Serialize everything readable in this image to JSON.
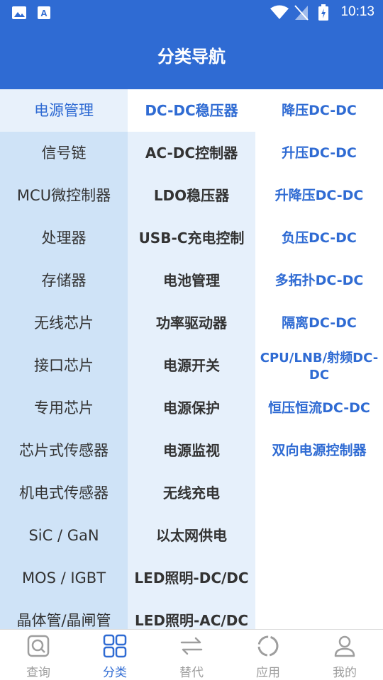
{
  "status_bar": {
    "time": "10:13"
  },
  "header": {
    "title": "分类导航"
  },
  "col1": [
    "电源管理",
    "信号链",
    "MCU微控制器",
    "处理器",
    "存储器",
    "无线芯片",
    "接口芯片",
    "专用芯片",
    "芯片式传感器",
    "机电式传感器",
    "SiC / GaN",
    "MOS / IGBT",
    "晶体管/晶闸管"
  ],
  "col2": [
    "DC-DC稳压器",
    "AC-DC控制器",
    "LDO稳压器",
    "USB-C充电控制",
    "电池管理",
    "功率驱动器",
    "电源开关",
    "电源保护",
    "电源监视",
    "无线充电",
    "以太网供电",
    "LED照明-DC/DC",
    "LED照明-AC/DC"
  ],
  "col3": [
    "降压DC-DC",
    "升压DC-DC",
    "升降压DC-DC",
    "负压DC-DC",
    "多拓扑DC-DC",
    "隔离DC-DC",
    "CPU/LNB/射频DC-DC",
    "恒压恒流DC-DC",
    "双向电源控制器"
  ],
  "bottom_nav": [
    {
      "label": "查询",
      "icon": "search-icon"
    },
    {
      "label": "分类",
      "icon": "grid-icon"
    },
    {
      "label": "替代",
      "icon": "swap-icon"
    },
    {
      "label": "应用",
      "icon": "ring-icon"
    },
    {
      "label": "我的",
      "icon": "person-icon"
    }
  ],
  "colors": {
    "primary": "#2f6bd3",
    "inactive": "#9e9e9e"
  }
}
